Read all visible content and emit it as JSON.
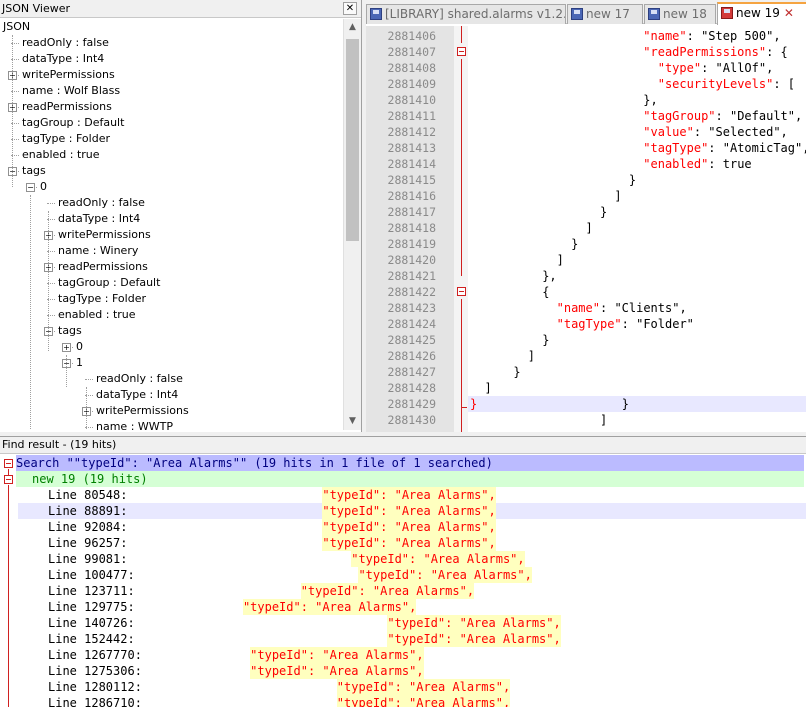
{
  "json_viewer": {
    "title": "JSON Viewer",
    "close_label": "✕",
    "tree": [
      {
        "label": "JSON",
        "depth": 0,
        "expander": ""
      },
      {
        "label": "readOnly : false",
        "depth": 1,
        "expander": ""
      },
      {
        "label": "dataType : Int4",
        "depth": 1,
        "expander": ""
      },
      {
        "label": "writePermissions",
        "depth": 1,
        "expander": "+"
      },
      {
        "label": "name : Wolf Blass",
        "depth": 1,
        "expander": ""
      },
      {
        "label": "readPermissions",
        "depth": 1,
        "expander": "+"
      },
      {
        "label": "tagGroup : Default",
        "depth": 1,
        "expander": ""
      },
      {
        "label": "tagType : Folder",
        "depth": 1,
        "expander": ""
      },
      {
        "label": "enabled : true",
        "depth": 1,
        "expander": ""
      },
      {
        "label": "tags",
        "depth": 1,
        "expander": "−"
      },
      {
        "label": "0",
        "depth": 2,
        "expander": "−"
      },
      {
        "label": "readOnly : false",
        "depth": 3,
        "expander": ""
      },
      {
        "label": "dataType : Int4",
        "depth": 3,
        "expander": ""
      },
      {
        "label": "writePermissions",
        "depth": 3,
        "expander": "+"
      },
      {
        "label": "name : Winery",
        "depth": 3,
        "expander": ""
      },
      {
        "label": "readPermissions",
        "depth": 3,
        "expander": "+"
      },
      {
        "label": "tagGroup : Default",
        "depth": 3,
        "expander": ""
      },
      {
        "label": "tagType : Folder",
        "depth": 3,
        "expander": ""
      },
      {
        "label": "enabled : true",
        "depth": 3,
        "expander": ""
      },
      {
        "label": "tags",
        "depth": 3,
        "expander": "−"
      },
      {
        "label": "0",
        "depth": 4,
        "expander": "+"
      },
      {
        "label": "1",
        "depth": 4,
        "expander": "−"
      },
      {
        "label": "readOnly : false",
        "depth": 5,
        "expander": ""
      },
      {
        "label": "dataType : Int4",
        "depth": 5,
        "expander": ""
      },
      {
        "label": "writePermissions",
        "depth": 5,
        "expander": "+"
      },
      {
        "label": "name : WWTP",
        "depth": 5,
        "expander": ""
      }
    ]
  },
  "editor": {
    "tabs": [
      {
        "label": "[LIBRARY] shared.alarms v1.2.py",
        "active": false,
        "icon": "file-icon"
      },
      {
        "label": "new 17",
        "active": false,
        "icon": "file-icon"
      },
      {
        "label": "new 18",
        "active": false,
        "icon": "file-icon"
      },
      {
        "label": "new 19",
        "active": true,
        "icon": "unsaved-file-icon"
      }
    ],
    "tab_close": "✕",
    "lines": [
      {
        "num": "2881406",
        "indent": 24,
        "parts": [
          [
            "k",
            "\"name\""
          ],
          [
            "p",
            ": "
          ],
          [
            "s",
            "\"Step 500\","
          ]
        ]
      },
      {
        "num": "2881407",
        "indent": 24,
        "parts": [
          [
            "k",
            "\"readPermissions\""
          ],
          [
            "p",
            ": {"
          ]
        ],
        "fold": true
      },
      {
        "num": "2881408",
        "indent": 26,
        "parts": [
          [
            "k",
            "\"type\""
          ],
          [
            "p",
            ": "
          ],
          [
            "s",
            "\"AllOf\","
          ]
        ]
      },
      {
        "num": "2881409",
        "indent": 26,
        "parts": [
          [
            "k",
            "\"securityLevels\""
          ],
          [
            "p",
            ": ["
          ]
        ]
      },
      {
        "num": "2881410",
        "indent": 24,
        "parts": [
          [
            "p",
            "},"
          ]
        ]
      },
      {
        "num": "2881411",
        "indent": 24,
        "parts": [
          [
            "k",
            "\"tagGroup\""
          ],
          [
            "p",
            ": "
          ],
          [
            "s",
            "\"Default\","
          ]
        ]
      },
      {
        "num": "2881412",
        "indent": 24,
        "parts": [
          [
            "k",
            "\"value\""
          ],
          [
            "p",
            ": "
          ],
          [
            "s",
            "\"Selected\","
          ]
        ]
      },
      {
        "num": "2881413",
        "indent": 24,
        "parts": [
          [
            "k",
            "\"tagType\""
          ],
          [
            "p",
            ": "
          ],
          [
            "s",
            "\"AtomicTag\","
          ]
        ]
      },
      {
        "num": "2881414",
        "indent": 24,
        "parts": [
          [
            "k",
            "\"enabled\""
          ],
          [
            "p",
            ": true"
          ]
        ]
      },
      {
        "num": "2881415",
        "indent": 22,
        "parts": [
          [
            "p",
            "}"
          ]
        ]
      },
      {
        "num": "2881416",
        "indent": 20,
        "parts": [
          [
            "p",
            "]"
          ]
        ]
      },
      {
        "num": "2881417",
        "indent": 18,
        "parts": [
          [
            "p",
            "}"
          ]
        ]
      },
      {
        "num": "2881418",
        "indent": 16,
        "parts": [
          [
            "p",
            "]"
          ]
        ]
      },
      {
        "num": "2881419",
        "indent": 14,
        "parts": [
          [
            "p",
            "}"
          ]
        ]
      },
      {
        "num": "2881420",
        "indent": 12,
        "parts": [
          [
            "p",
            "]"
          ]
        ]
      },
      {
        "num": "2881421",
        "indent": 10,
        "parts": [
          [
            "p",
            "},"
          ]
        ]
      },
      {
        "num": "2881422",
        "indent": 10,
        "parts": [
          [
            "p",
            "{"
          ]
        ],
        "fold": true
      },
      {
        "num": "2881423",
        "indent": 12,
        "parts": [
          [
            "k",
            "\"name\""
          ],
          [
            "p",
            ": "
          ],
          [
            "s",
            "\"Clients\","
          ]
        ]
      },
      {
        "num": "2881424",
        "indent": 12,
        "parts": [
          [
            "k",
            "\"tagType\""
          ],
          [
            "p",
            ": "
          ],
          [
            "s",
            "\"Folder\""
          ]
        ]
      },
      {
        "num": "2881425",
        "indent": 10,
        "parts": [
          [
            "p",
            "}"
          ]
        ]
      },
      {
        "num": "2881426",
        "indent": 8,
        "parts": [
          [
            "p",
            "]"
          ]
        ]
      },
      {
        "num": "2881427",
        "indent": 6,
        "parts": [
          [
            "p",
            "}"
          ]
        ]
      },
      {
        "num": "2881428",
        "indent": 2,
        "parts": [
          [
            "p",
            "]"
          ]
        ]
      },
      {
        "num": "2881429",
        "indent": 0,
        "parts": [
          [
            "k",
            "}"
          ],
          [
            "p",
            "                    }"
          ]
        ],
        "cur": true
      },
      {
        "num": "2881430",
        "indent": 18,
        "parts": [
          [
            "p",
            "]"
          ]
        ]
      }
    ]
  },
  "find_results": {
    "title": "Find result - (19 hits)",
    "search_line": "Search \"\"typeId\": \"Area Alarms\"\" (19 hits in 1 file of 1 searched)",
    "file_line": "new 19 (19 hits)",
    "hit_text": "\"typeId\": \"Area Alarms\"",
    "hits": [
      {
        "line": "Line 80548:",
        "indent": 38,
        "cur": false
      },
      {
        "line": "Line 88891:",
        "indent": 38,
        "cur": true
      },
      {
        "line": "Line 92084:",
        "indent": 38,
        "cur": false
      },
      {
        "line": "Line 96257:",
        "indent": 38,
        "cur": false
      },
      {
        "line": "Line 99081:",
        "indent": 42,
        "cur": false
      },
      {
        "line": "Line 100477:",
        "indent": 43,
        "cur": false
      },
      {
        "line": "Line 123711:",
        "indent": 35,
        "cur": false
      },
      {
        "line": "Line 129775:",
        "indent": 27,
        "cur": false
      },
      {
        "line": "Line 140726:",
        "indent": 47,
        "cur": false
      },
      {
        "line": "Line 152442:",
        "indent": 47,
        "cur": false
      },
      {
        "line": "Line 1267770:",
        "indent": 28,
        "cur": false
      },
      {
        "line": "Line 1275306:",
        "indent": 28,
        "cur": false
      },
      {
        "line": "Line 1280112:",
        "indent": 40,
        "cur": false
      },
      {
        "line": "Line 1286710:",
        "indent": 40,
        "cur": false
      }
    ]
  }
}
